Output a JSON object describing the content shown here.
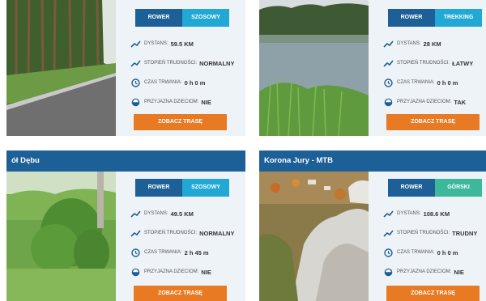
{
  "colors": {
    "title_bar": "#1d5f97",
    "tag_primary": "#1d5f97",
    "tag_road": "#22a8d4",
    "tag_mountain": "#3db89b",
    "button": "#e87a24",
    "panel": "#eef3f7"
  },
  "labels": {
    "distance": "DYSTANS:",
    "difficulty": "STOPIEŃ TRUDNOŚCI:",
    "duration": "CZAS TRWANIA:",
    "kids": "PRZYJAZNA DZIECIOM:"
  },
  "cards": [
    {
      "title": "",
      "tag1": "ROWER",
      "tag2": "SZOSOWY",
      "distance": "59.5 KM",
      "difficulty": "NORMALNY",
      "duration": "0 h 0 m",
      "kids": "NIE",
      "button": "ZOBACZ TRASĘ",
      "image": "forest-road-photo"
    },
    {
      "title": "",
      "tag1": "ROWER",
      "tag2": "TREKKING",
      "distance": "28 KM",
      "difficulty": "ŁATWY",
      "duration": "0 h 0 m",
      "kids": "TAK",
      "button": "ZOBACZ TRASĘ",
      "image": "lake-photo"
    },
    {
      "title": "ół Dębu",
      "tag1": "ROWER",
      "tag2": "SZOSOWY",
      "distance": "49.5 KM",
      "difficulty": "NORMALNY",
      "duration": "2 h 45 m",
      "kids": "NIE",
      "button": "ZOBACZ TRASĘ",
      "image": "meadow-photo"
    },
    {
      "title": "Korona Jury - MTB",
      "tag1": "ROWER",
      "tag2": "GÓRSKI",
      "distance": "108.6 KM",
      "difficulty": "TRUDNY",
      "duration": "0 h 0 m",
      "kids": "NIE",
      "button": "ZOBACZ TRASĘ",
      "image": "rocks-photo"
    }
  ]
}
